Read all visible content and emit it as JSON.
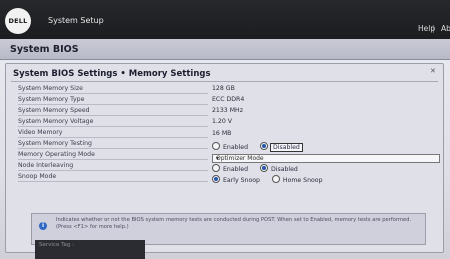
{
  "header": {
    "logo_text": "DELL",
    "app_title": "System Setup",
    "help_label": "Help",
    "separator": "|",
    "about_label": "Ab"
  },
  "bios": {
    "title": "System BIOS"
  },
  "panel": {
    "title": "System BIOS Settings • Memory Settings",
    "close_glyph": "✕"
  },
  "settings": {
    "memory_size": {
      "label": "System Memory Size",
      "value": "128 GB"
    },
    "memory_type": {
      "label": "System Memory Type",
      "value": "ECC DDR4"
    },
    "memory_speed": {
      "label": "System Memory Speed",
      "value": "2133 MHz"
    },
    "memory_voltage": {
      "label": "System Memory Voltage",
      "value": "1.20 V"
    },
    "video_memory": {
      "label": "Video Memory",
      "value": "16 MB"
    },
    "memory_testing": {
      "label": "System Memory Testing",
      "options": [
        "Enabled",
        "Disabled"
      ],
      "selected": "Disabled"
    },
    "operating_mode": {
      "label": "Memory Operating Mode",
      "value": "Optimizer Mode"
    },
    "node_interleaving": {
      "label": "Node Interleaving",
      "options": [
        "Enabled",
        "Disabled"
      ],
      "selected": "Disabled"
    },
    "snoop_mode": {
      "label": "Snoop Mode",
      "options": [
        "Early Snoop",
        "Home Snoop"
      ],
      "selected": "Early Snoop"
    }
  },
  "info": {
    "icon_glyph": "i",
    "text": "Indicates whether or not the BIOS system memory tests are conducted during POST. When set to Enabled, memory tests are performed. (Press <F1> for more help.)"
  },
  "footer": {
    "line1": "Service Tag : ",
    "line2": ""
  },
  "colors": {
    "accent": "#2457a8",
    "header_bg": "#1b1c1f",
    "screen_bg": "#e3e4eb"
  }
}
